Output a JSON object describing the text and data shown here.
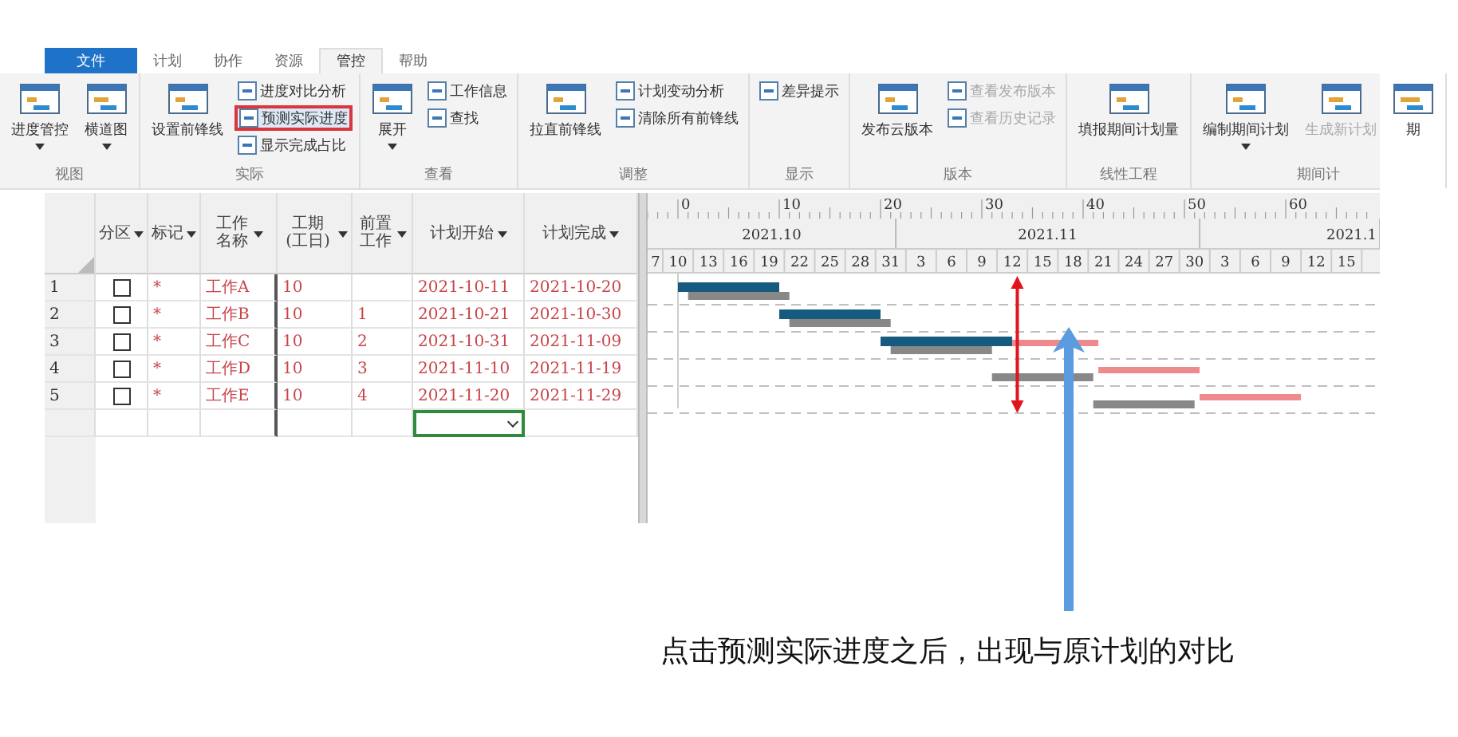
{
  "tabs": [
    {
      "label": "文件",
      "kind": "file",
      "selected": false
    },
    {
      "label": "计划",
      "kind": "tab",
      "selected": false
    },
    {
      "label": "协作",
      "kind": "tab",
      "selected": false
    },
    {
      "label": "资源",
      "kind": "tab",
      "selected": false
    },
    {
      "label": "管控",
      "kind": "tab",
      "selected": true
    },
    {
      "label": "帮助",
      "kind": "tab",
      "selected": false
    }
  ],
  "ribbon": [
    {
      "label": "视图",
      "items": [
        {
          "kind": "large",
          "label": "进度管控",
          "dropdown": true,
          "disabled": false,
          "highlighted": false
        },
        {
          "kind": "large",
          "label": "横道图",
          "dropdown": true,
          "disabled": false,
          "highlighted": false
        }
      ]
    },
    {
      "label": "实际",
      "items": [
        {
          "kind": "large",
          "label": "设置前锋线",
          "dropdown": false,
          "disabled": false,
          "highlighted": false
        },
        {
          "kind": "small",
          "label": "进度对比分析",
          "dropdown": false,
          "disabled": false,
          "highlighted": false
        },
        {
          "kind": "small",
          "label": "预测实际进度",
          "dropdown": false,
          "disabled": false,
          "highlighted": true
        },
        {
          "kind": "small",
          "label": "显示完成占比",
          "dropdown": false,
          "disabled": false,
          "highlighted": false
        }
      ]
    },
    {
      "label": "查看",
      "items": [
        {
          "kind": "large",
          "label": "展开",
          "dropdown": true,
          "disabled": false,
          "highlighted": false
        },
        {
          "kind": "small",
          "label": "工作信息",
          "dropdown": false,
          "disabled": false,
          "highlighted": false
        },
        {
          "kind": "small",
          "label": "查找",
          "dropdown": false,
          "disabled": false,
          "highlighted": false
        }
      ]
    },
    {
      "label": "调整",
      "items": [
        {
          "kind": "large",
          "label": "拉直前锋线",
          "dropdown": false,
          "disabled": false,
          "highlighted": false
        },
        {
          "kind": "small",
          "label": "计划变动分析",
          "dropdown": false,
          "disabled": false,
          "highlighted": false
        },
        {
          "kind": "small",
          "label": "清除所有前锋线",
          "dropdown": false,
          "disabled": false,
          "highlighted": false
        }
      ]
    },
    {
      "label": "显示",
      "items": [
        {
          "kind": "small",
          "label": "差异提示",
          "dropdown": false,
          "disabled": false,
          "highlighted": false
        }
      ]
    },
    {
      "label": "版本",
      "items": [
        {
          "kind": "large",
          "label": "发布云版本",
          "dropdown": false,
          "disabled": false,
          "highlighted": false
        },
        {
          "kind": "small",
          "label": "查看发布版本",
          "dropdown": false,
          "disabled": true,
          "highlighted": false
        },
        {
          "kind": "small",
          "label": "查看历史记录",
          "dropdown": false,
          "disabled": true,
          "highlighted": false
        }
      ]
    },
    {
      "label": "线性工程",
      "items": [
        {
          "kind": "large",
          "label": "填报期间计划量",
          "dropdown": false,
          "disabled": false,
          "highlighted": false
        }
      ]
    },
    {
      "label": "期间计",
      "items": [
        {
          "kind": "large",
          "label": "编制期间计划",
          "dropdown": true,
          "disabled": false,
          "highlighted": false
        },
        {
          "kind": "large",
          "label": "生成新计划",
          "dropdown": false,
          "disabled": true,
          "highlighted": false
        },
        {
          "kind": "large",
          "label": "期",
          "dropdown": false,
          "disabled": false,
          "highlighted": false
        }
      ]
    }
  ],
  "table": {
    "columns": [
      {
        "label": "分区",
        "dropdown": true
      },
      {
        "label": "标记",
        "dropdown": true
      },
      {
        "label": "工作名称",
        "dropdown": true
      },
      {
        "label": "工期(工日)",
        "dropdown": true
      },
      {
        "label": "前置工作",
        "dropdown": true
      },
      {
        "label": "计划开始",
        "dropdown": true
      },
      {
        "label": "计划完成",
        "dropdown": true
      }
    ],
    "rows": [
      {
        "number": "1",
        "checked": false,
        "mark": "*",
        "name": "工作A",
        "duration": "10",
        "predecessor": "",
        "start": "2021-10-11",
        "finish": "2021-10-20"
      },
      {
        "number": "2",
        "checked": false,
        "mark": "*",
        "name": "工作B",
        "duration": "10",
        "predecessor": "1",
        "start": "2021-10-21",
        "finish": "2021-10-30"
      },
      {
        "number": "3",
        "checked": false,
        "mark": "*",
        "name": "工作C",
        "duration": "10",
        "predecessor": "2",
        "start": "2021-10-31",
        "finish": "2021-11-09"
      },
      {
        "number": "4",
        "checked": false,
        "mark": "*",
        "name": "工作D",
        "duration": "10",
        "predecessor": "3",
        "start": "2021-11-10",
        "finish": "2021-11-19"
      },
      {
        "number": "5",
        "checked": false,
        "mark": "*",
        "name": "工作E",
        "duration": "10",
        "predecessor": "4",
        "start": "2021-11-20",
        "finish": "2021-11-29"
      }
    ],
    "blank_row": [
      {
        "active": false
      },
      {
        "active": false
      },
      {
        "active": false
      },
      {
        "active": false
      },
      {
        "active": false
      },
      {
        "active": true
      },
      {
        "active": false
      }
    ]
  },
  "timescale": {
    "ruler": [
      "0",
      "10",
      "20",
      "30",
      "40",
      "50",
      "60"
    ],
    "months": [
      "2021.10",
      "2021.11",
      "2021.1"
    ],
    "days": [
      "7",
      "10",
      "13",
      "16",
      "19",
      "22",
      "25",
      "28",
      "31",
      "3",
      "6",
      "9",
      "12",
      "15",
      "18",
      "21",
      "24",
      "27",
      "30",
      "3",
      "6",
      "9",
      "12",
      "15"
    ]
  },
  "caption": "点击预测实际进度之后，出现与原计划的对比"
}
